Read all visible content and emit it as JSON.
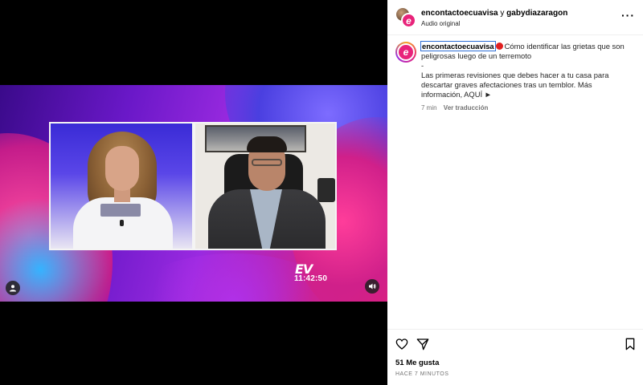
{
  "post": {
    "account_names": "encontactoecuavisa",
    "conjunction": "y",
    "coauthor": "gabydiazaragon",
    "audio_label": "Audio original",
    "more_icon": "more-horizontal-icon"
  },
  "video": {
    "clock_text": "11:42:50",
    "channel_logo_text": "EV",
    "user_icon": "user-tag-icon",
    "audio_icon": "speaker-icon"
  },
  "caption": {
    "username": "encontactoecuavisa",
    "line1": "Cómo identificar las grietas que son peligrosas luego de un terremoto",
    "separator": "-",
    "line2": "Las primeras revisiones que debes hacer a tu casa para descartar graves afectaciones tras un temblor. Más información, AQUÍ ►",
    "time_ago": "7 min",
    "translate_label": "Ver traducción"
  },
  "actions": {
    "likes_text": "51 Me gusta",
    "posted_text": "HACE 7 MINUTOS",
    "like_icon": "heart-icon",
    "share_icon": "send-icon",
    "save_icon": "bookmark-icon"
  },
  "colors": {
    "brand_pink": "#e8237a",
    "live_red": "#e02020"
  }
}
